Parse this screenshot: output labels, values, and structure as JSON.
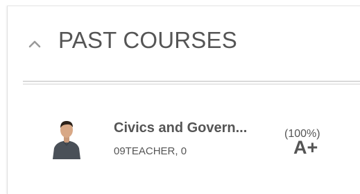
{
  "section": {
    "title": "PAST COURSES",
    "toggle_icon": "chevron-up-icon"
  },
  "courses": [
    {
      "name": "Civics and Govern...",
      "teacher": "09TEACHER, 0",
      "percent": "(100%)",
      "grade": "A+",
      "avatar_icon": "teacher-avatar"
    }
  ]
}
